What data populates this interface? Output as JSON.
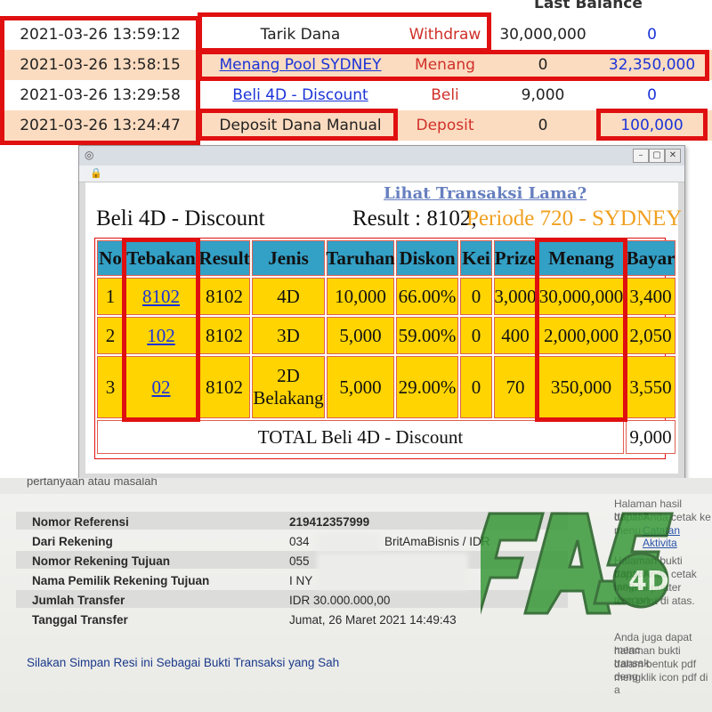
{
  "top_table": {
    "header_last_balance": "Last Balance",
    "rows": [
      {
        "date": "2021-03-26 13:59:12",
        "desc": "Tarik Dana",
        "type": "Withdraw",
        "debit": "30,000,000",
        "balance": "0"
      },
      {
        "date": "2021-03-26 13:58:15",
        "desc": "Menang Pool SYDNEY",
        "type": "Menang",
        "debit": "0",
        "balance": "32,350,000"
      },
      {
        "date": "2021-03-26 13:29:58",
        "desc": "Beli 4D - Discount",
        "type": "Beli",
        "debit": "9,000",
        "balance": "0"
      },
      {
        "date": "2021-03-26 13:24:47",
        "desc": "Deposit Dana Manual",
        "type": "Deposit",
        "debit": "0",
        "balance": "100,000"
      }
    ],
    "colors": {
      "row_odd": "#ffffff",
      "row_even": "#fcdcc0",
      "accent_red": "#e01010",
      "link_blue": "#1a33d8"
    }
  },
  "popup": {
    "bg_link": "Lihat Transaksi Lama?",
    "title_left": "Beli 4D - Discount",
    "title_result": "Result : 8102,",
    "title_periode": "Periode 720 - SYDNEY",
    "headers": [
      "No",
      "Tebakan",
      "Result",
      "Jenis",
      "Taruhan",
      "Diskon",
      "Kei",
      "Prize",
      "Menang",
      "Bayar"
    ],
    "rows": [
      {
        "no": "1",
        "tebakan": "8102",
        "result": "8102",
        "jenis": "4D",
        "jenis2": "",
        "taruhan": "10,000",
        "diskon": "66.00%",
        "kei": "0",
        "prize": "3,000",
        "menang": "30,000,000",
        "bayar": "3,400"
      },
      {
        "no": "2",
        "tebakan": "102",
        "result": "8102",
        "jenis": "3D",
        "jenis2": "",
        "taruhan": "5,000",
        "diskon": "59.00%",
        "kei": "0",
        "prize": "400",
        "menang": "2,000,000",
        "bayar": "2,050"
      },
      {
        "no": "3",
        "tebakan": "02",
        "result": "8102",
        "jenis": "2D",
        "jenis2": "Belakang",
        "taruhan": "5,000",
        "diskon": "29.00%",
        "kei": "0",
        "prize": "70",
        "menang": "350,000",
        "bayar": "3,550"
      }
    ],
    "total_label": "TOTAL  Beli 4D - Discount",
    "total_value": "9,000",
    "colors": {
      "header": "#33a0c6",
      "cell": "#ffd400",
      "periode": "#f0a020"
    }
  },
  "receipt": {
    "top_note": "pertanyaan atau masalah",
    "fields": [
      {
        "label": "Nomor Referensi",
        "value": "219412357999"
      },
      {
        "label": "Dari Rekening",
        "value": "034",
        "extra": "BritAmaBisnis / IDR"
      },
      {
        "label": "Nomor Rekening Tujuan",
        "value": "055"
      },
      {
        "label": "Nama Pemilik Rekening Tujuan",
        "value": "I NY"
      },
      {
        "label": "Jumlah Transfer",
        "value": "IDR 30.000.000,00"
      },
      {
        "label": "Tanggal Transfer",
        "value": "Jumat, 26 Maret 2021 14:49:43"
      }
    ],
    "note": "Silakan Simpan Resi ini Sebagai Bukti Transaksi yang Sah",
    "side_lines": [
      "Halaman hasil transak",
      "dapat Anda cetak ke",
      "menu",
      "Catatan Aktivita",
      "Halaman bukti transak",
      "dapat Anda cetak lang",
      "melalui printer dengan",
      "icon print di atas.",
      "Anda juga dapat menc",
      "halaman bukti transak",
      "dalam bentuk pdf deng",
      "mengklik icon pdf di a"
    ],
    "watermark": "PAS4D"
  }
}
